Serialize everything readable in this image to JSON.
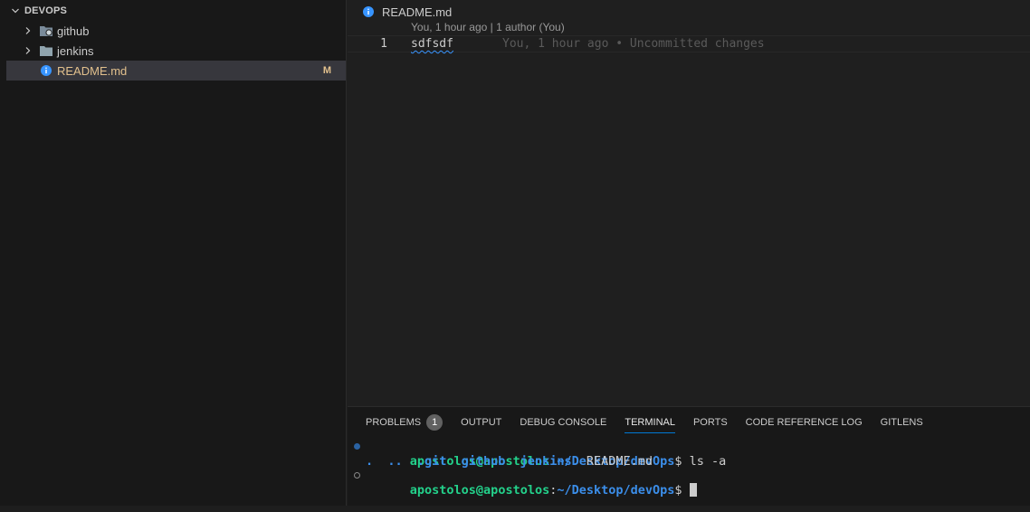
{
  "explorer": {
    "section_title": "DEVOPS",
    "items": [
      {
        "label": "github",
        "type": "folder",
        "icon": "github-folder-icon"
      },
      {
        "label": "jenkins",
        "type": "folder",
        "icon": "folder-icon"
      },
      {
        "label": "README.md",
        "type": "file",
        "icon": "info-icon",
        "status": "M"
      }
    ]
  },
  "editor": {
    "breadcrumb_file": "README.md",
    "codelens": "You, 1 hour ago | 1 author (You)",
    "line_number": "1",
    "line_text": "sdfsdf",
    "blame": "You, 1 hour ago • Uncommitted changes"
  },
  "panel": {
    "tabs": {
      "problems": "PROBLEMS",
      "problems_count": "1",
      "output": "OUTPUT",
      "debug_console": "DEBUG CONSOLE",
      "terminal": "TERMINAL",
      "ports": "PORTS",
      "code_reference_log": "CODE REFERENCE LOG",
      "gitlens": "GITLENS"
    },
    "terminal": {
      "user_host": "apostolos@apostolos",
      "colon": ":",
      "path": "~/Desktop/devOps",
      "prompt_char": "$ ",
      "command": "ls -a",
      "output_blue": ".  ..  .git  github  jenkins",
      "output_plain": "  README.md"
    }
  },
  "colors": {
    "accent": "#0078d4",
    "modified": "#e2c08d",
    "info_icon": "#3794ff",
    "prompt_user": "#23d18b",
    "prompt_path": "#3b8eea"
  }
}
